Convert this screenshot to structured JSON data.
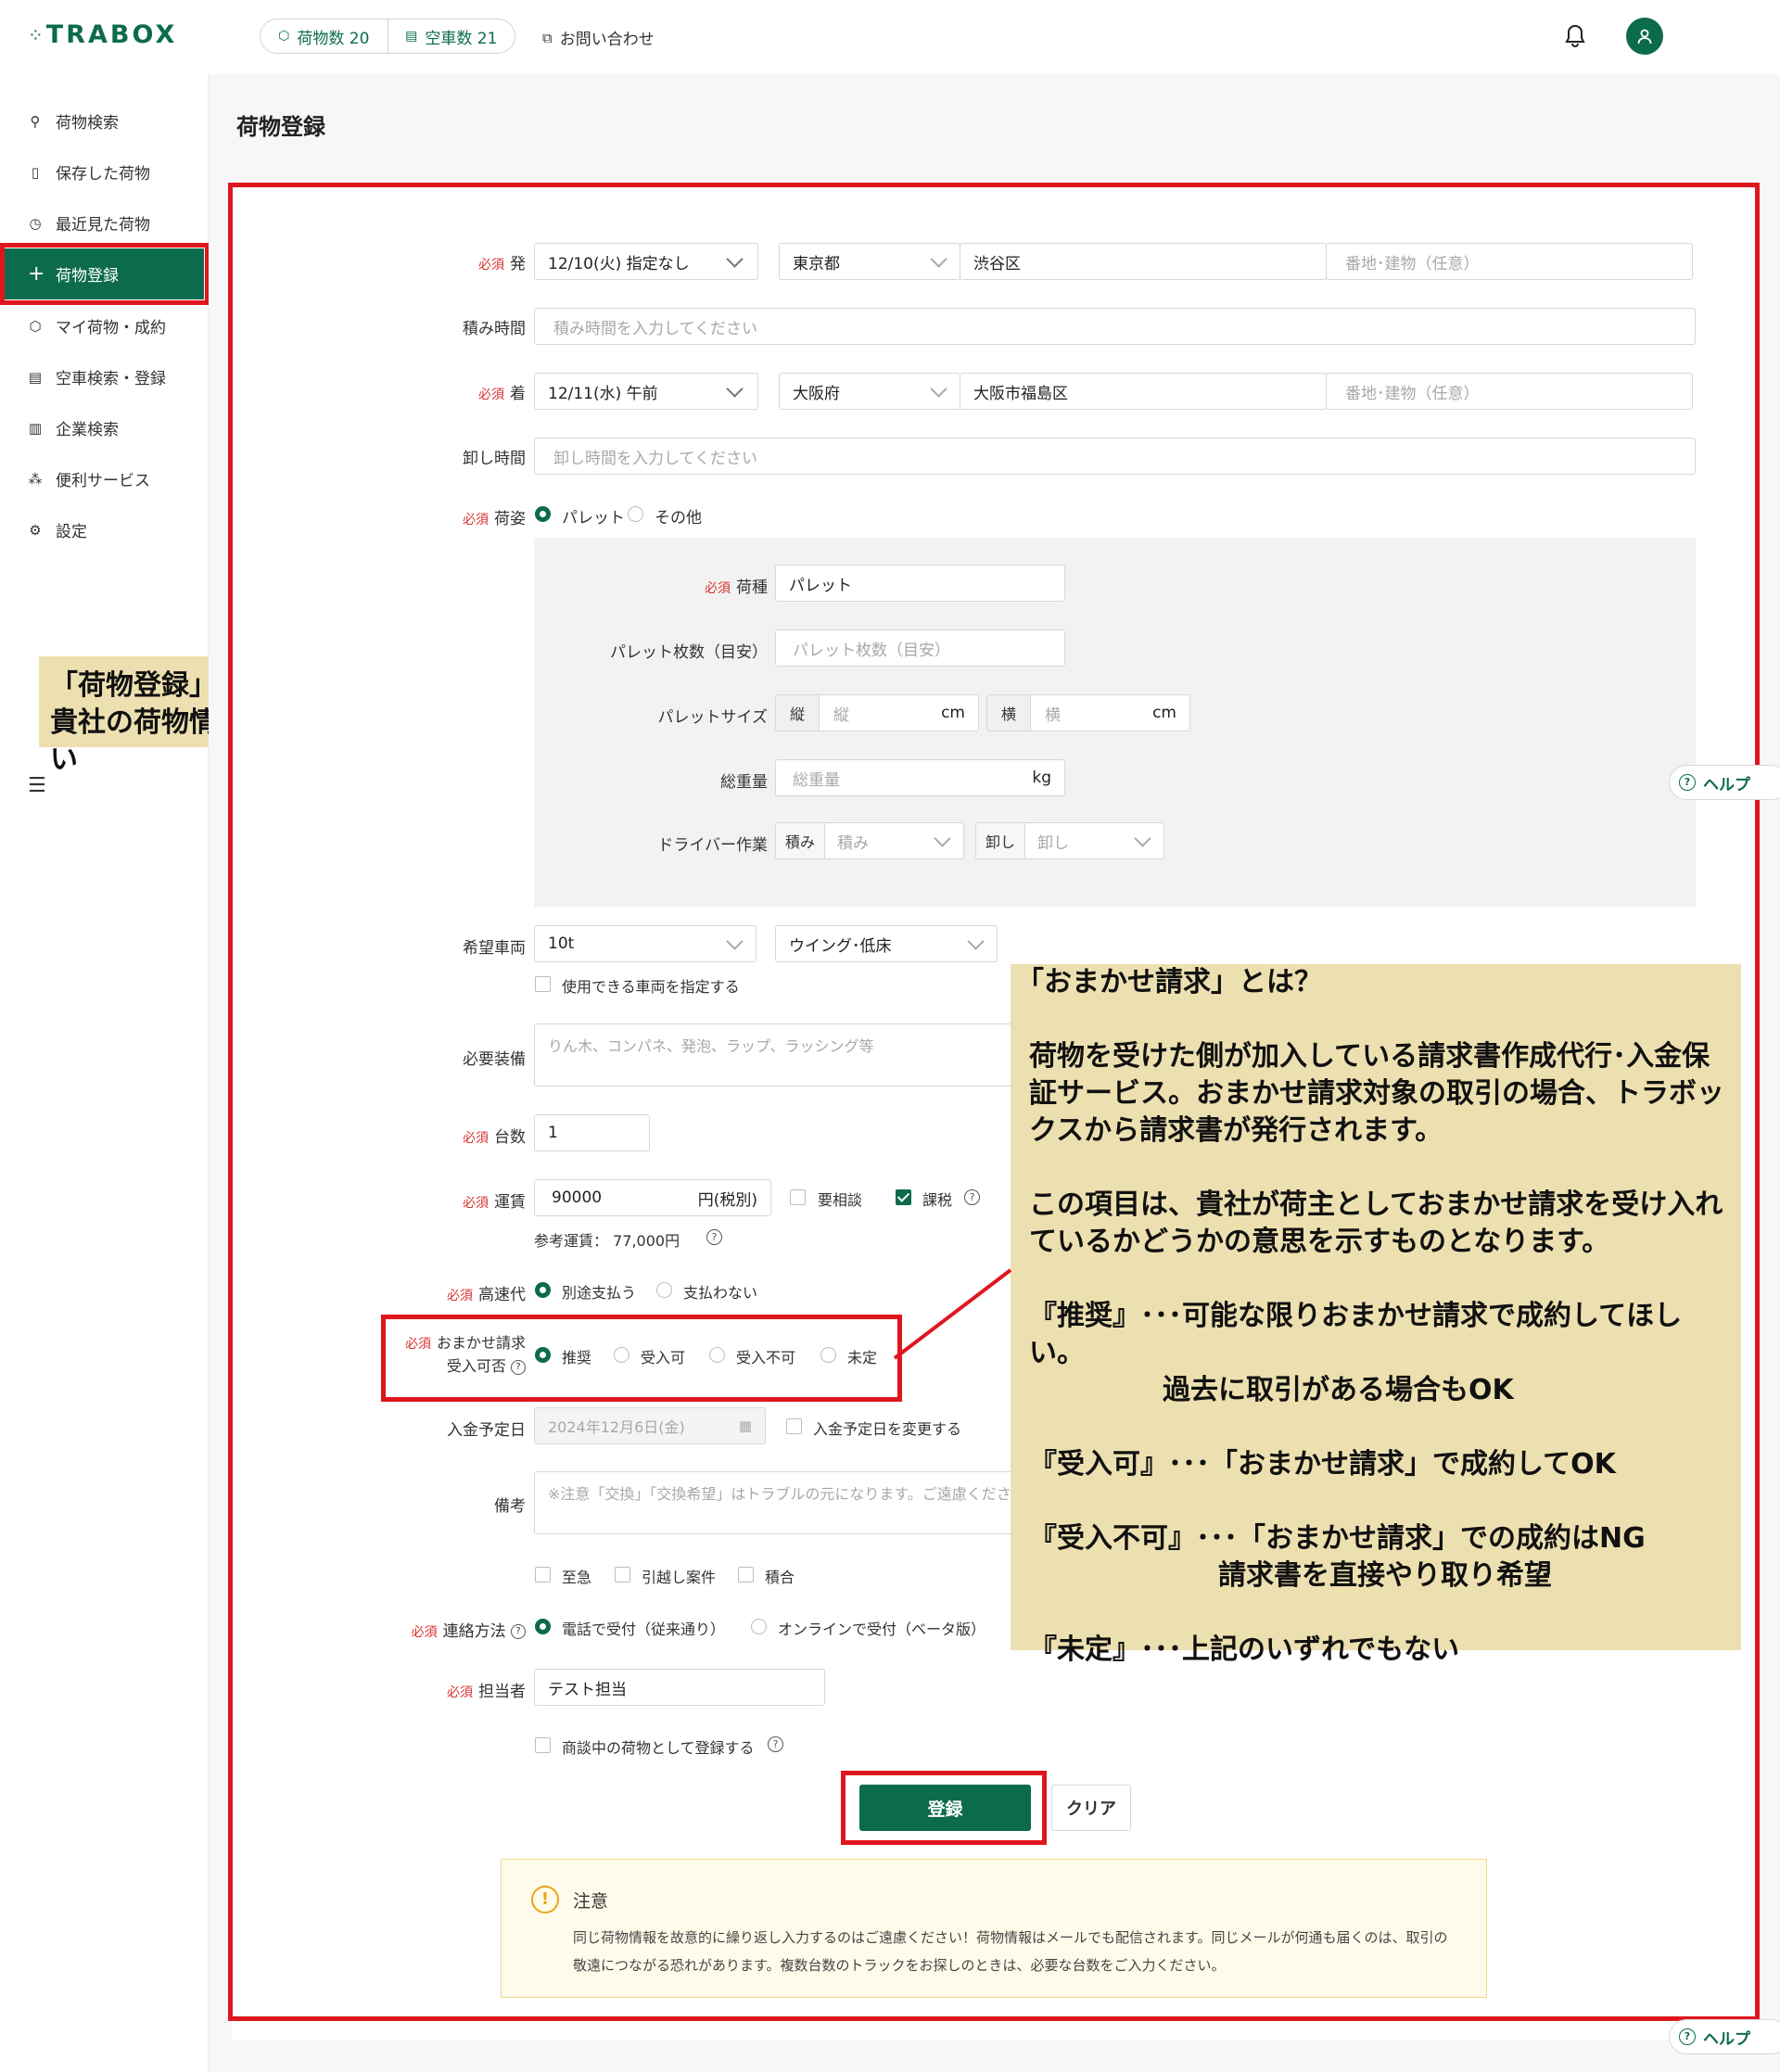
{
  "header": {
    "logo": "TRABOX",
    "cargo_count_label": "荷物数 20",
    "vehicle_count_label": "空車数 21",
    "contact_label": "お問い合わせ"
  },
  "sidebar": {
    "items": [
      {
        "label": "荷物検索",
        "icon": "search-icon"
      },
      {
        "label": "保存した荷物",
        "icon": "bookmark-icon"
      },
      {
        "label": "最近見た荷物",
        "icon": "history-icon"
      },
      {
        "label": "荷物登録",
        "icon": "plus-icon"
      },
      {
        "label": "マイ荷物・成約",
        "icon": "box-icon"
      },
      {
        "label": "空車検索・登録",
        "icon": "truck-icon"
      },
      {
        "label": "企業検索",
        "icon": "building-icon"
      },
      {
        "label": "便利サービス",
        "icon": "service-icon"
      },
      {
        "label": "設定",
        "icon": "gear-icon"
      }
    ]
  },
  "page_title": "荷物登録",
  "required_label": "必須",
  "form": {
    "departure": {
      "label": "発",
      "date": "12/10(火) 指定なし",
      "prefecture": "東京都",
      "city": "渋谷区",
      "address_placeholder": "番地･建物（任意）"
    },
    "loading_time": {
      "label": "積み時間",
      "placeholder": "積み時間を入力してください"
    },
    "arrival": {
      "label": "着",
      "date": "12/11(水) 午前",
      "prefecture": "大阪府",
      "city": "大阪市福島区",
      "address_placeholder": "番地･建物（任意）"
    },
    "unloading_time": {
      "label": "卸し時間",
      "placeholder": "卸し時間を入力してください"
    },
    "package_style": {
      "label": "荷姿",
      "options": [
        "パレット",
        "その他"
      ],
      "selected": "パレット"
    },
    "cargo_type": {
      "label": "荷種",
      "value": "パレット"
    },
    "pallet_count": {
      "label": "パレット枚数（目安）",
      "placeholder": "パレット枚数（目安）"
    },
    "pallet_size": {
      "label": "パレットサイズ",
      "length_label": "縦",
      "length_placeholder": "縦",
      "width_label": "横",
      "width_placeholder": "横",
      "unit": "cm"
    },
    "total_weight": {
      "label": "総重量",
      "placeholder": "総重量",
      "unit": "kg"
    },
    "driver_work": {
      "label": "ドライバー作業",
      "load_label": "積み",
      "load_placeholder": "積み",
      "unload_label": "卸し",
      "unload_placeholder": "卸し"
    },
    "vehicle": {
      "label": "希望車両",
      "size": "10t",
      "type": "ウイング･低床",
      "specify_label": "使用できる車両を指定する"
    },
    "equipment": {
      "label": "必要装備",
      "placeholder": "りん木、コンパネ、発泡、ラップ、ラッシング等"
    },
    "units": {
      "label": "台数",
      "value": "1"
    },
    "fare": {
      "label": "運賃",
      "value": "90000",
      "unit": "円(税別)",
      "negotiable_label": "要相談",
      "taxable_label": "課税",
      "reference_label": "参考運賃：",
      "reference_value": "77,000円"
    },
    "highway": {
      "label": "高速代",
      "options": [
        "別途支払う",
        "支払わない"
      ],
      "selected": "別途支払う"
    },
    "omakase": {
      "label_line1": "おまかせ請求",
      "label_line2": "受入可否",
      "options": [
        "推奨",
        "受入可",
        "受入不可",
        "未定"
      ],
      "selected": "推奨"
    },
    "payment_date": {
      "label": "入金予定日",
      "placeholder": "2024年12月6日(金)",
      "change_label": "入金予定日を変更する"
    },
    "remarks": {
      "label": "備考",
      "placeholder": "※注意「交換」「交換希望」はトラブルの元になります。ご遠慮ください。"
    },
    "flags": [
      "至急",
      "引越し案件",
      "積合"
    ],
    "contact_method": {
      "label": "連絡方法",
      "options": [
        "電話で受付（従来通り）",
        "オンラインで受付（ベータ版）"
      ],
      "selected": "電話で受付（従来通り）"
    },
    "person": {
      "label": "担当者",
      "value": "テスト担当"
    },
    "negotiating_label": "商談中の荷物として登録する",
    "submit_label": "登録",
    "clear_label": "クリア"
  },
  "notice": {
    "title": "注意",
    "line1": "同じ荷物情報を故意的に繰り返し入力するのはご遠慮ください！荷物情報はメールでも配信されます。同じメールが何通も届くのは、取引の",
    "line2": "敬遠につながる恐れがあります。複数台数のトラックをお探しのときは、必要な台数をご入力ください。"
  },
  "help_label": "ヘルプ",
  "annotations": {
    "left_line1": "「荷物登録」クリックし、",
    "left_line2": "貴社の荷物情報を入力してください",
    "right_title": "「おまかせ請求」とは？",
    "right_p1": "荷物を受けた側が加入している請求書作成代行･入金保証サービス。おまかせ請求対象の取引の場合、トラボックスから請求書が発行されます。",
    "right_p2": "この項目は、貴社が荷主としておまかせ請求を受け入れているかどうかの意思を示すものとなります。",
    "right_p3a": "『推奨』･･･可能な限りおまかせ請求で成約してほしい。",
    "right_p3b": "過去に取引がある場合もOK",
    "right_p4": "『受入可』･･･「おまかせ請求」で成約してOK",
    "right_p5a": "『受入不可』･･･「おまかせ請求」での成約はNG",
    "right_p5b": "請求書を直接やり取り希望",
    "right_p6": "『未定』･･･上記のいずれでもない"
  },
  "colors": {
    "brand": "#0c6b4c",
    "annotation_red": "#e0161e",
    "callout_bg": "#ede0b0",
    "required": "#d9302f"
  }
}
